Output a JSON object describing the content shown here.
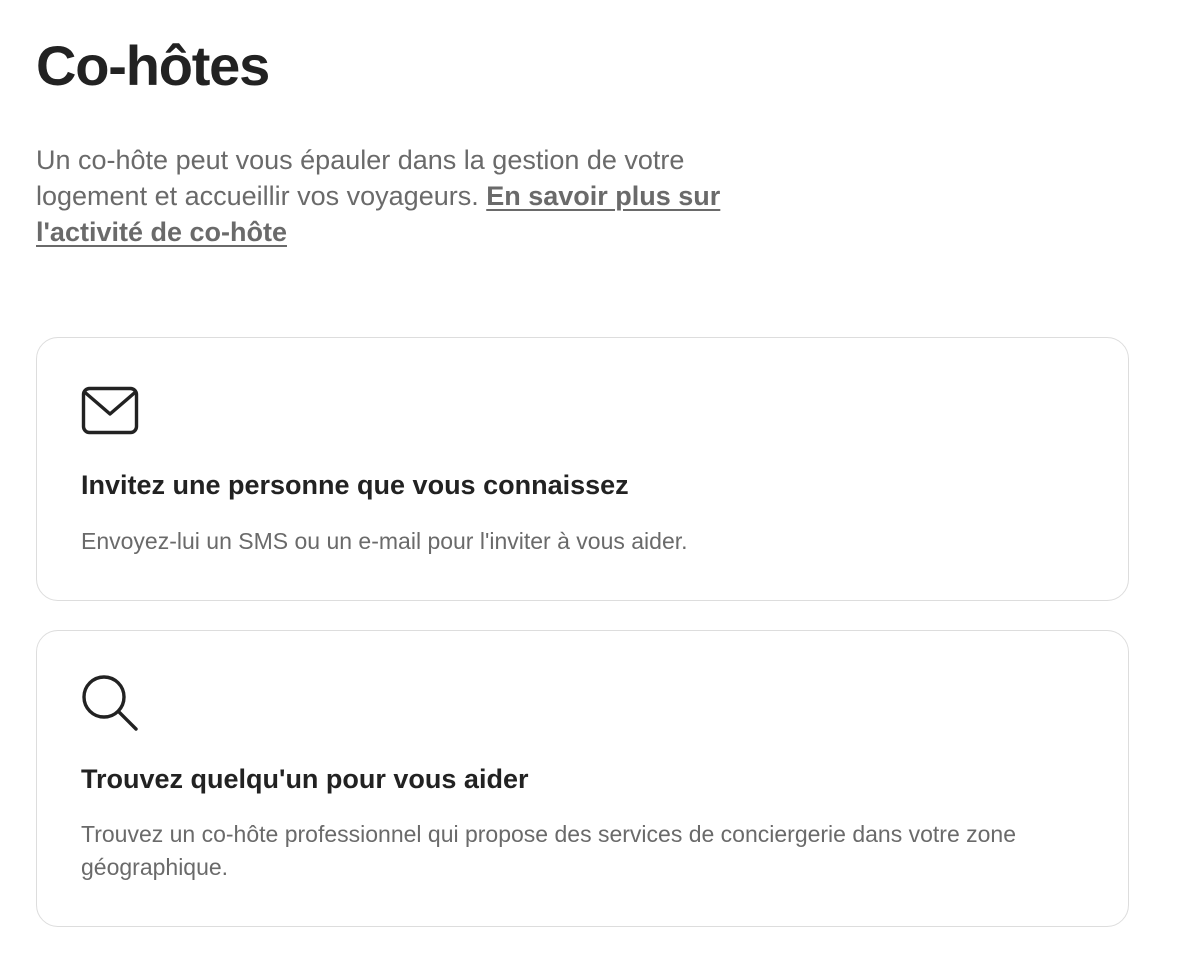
{
  "page": {
    "title": "Co-hôtes",
    "intro_text": "Un co-hôte peut vous épauler dans la gestion de votre logement et accueillir vos voyageurs. ",
    "learn_more_link": "En savoir plus sur l'activité de co-hôte"
  },
  "cards": [
    {
      "icon": "envelope-icon",
      "title": "Invitez une personne que vous connaissez",
      "description": "Envoyez-lui un SMS ou un e-mail pour l'inviter à vous aider."
    },
    {
      "icon": "search-icon",
      "title": "Trouvez quelqu'un pour vous aider",
      "description": "Trouvez un co-hôte professionnel qui propose des services de conciergerie dans votre zone géographique."
    }
  ],
  "colors": {
    "heading": "#222222",
    "body_text": "#6a6a6a",
    "card_border": "#dddddd"
  }
}
